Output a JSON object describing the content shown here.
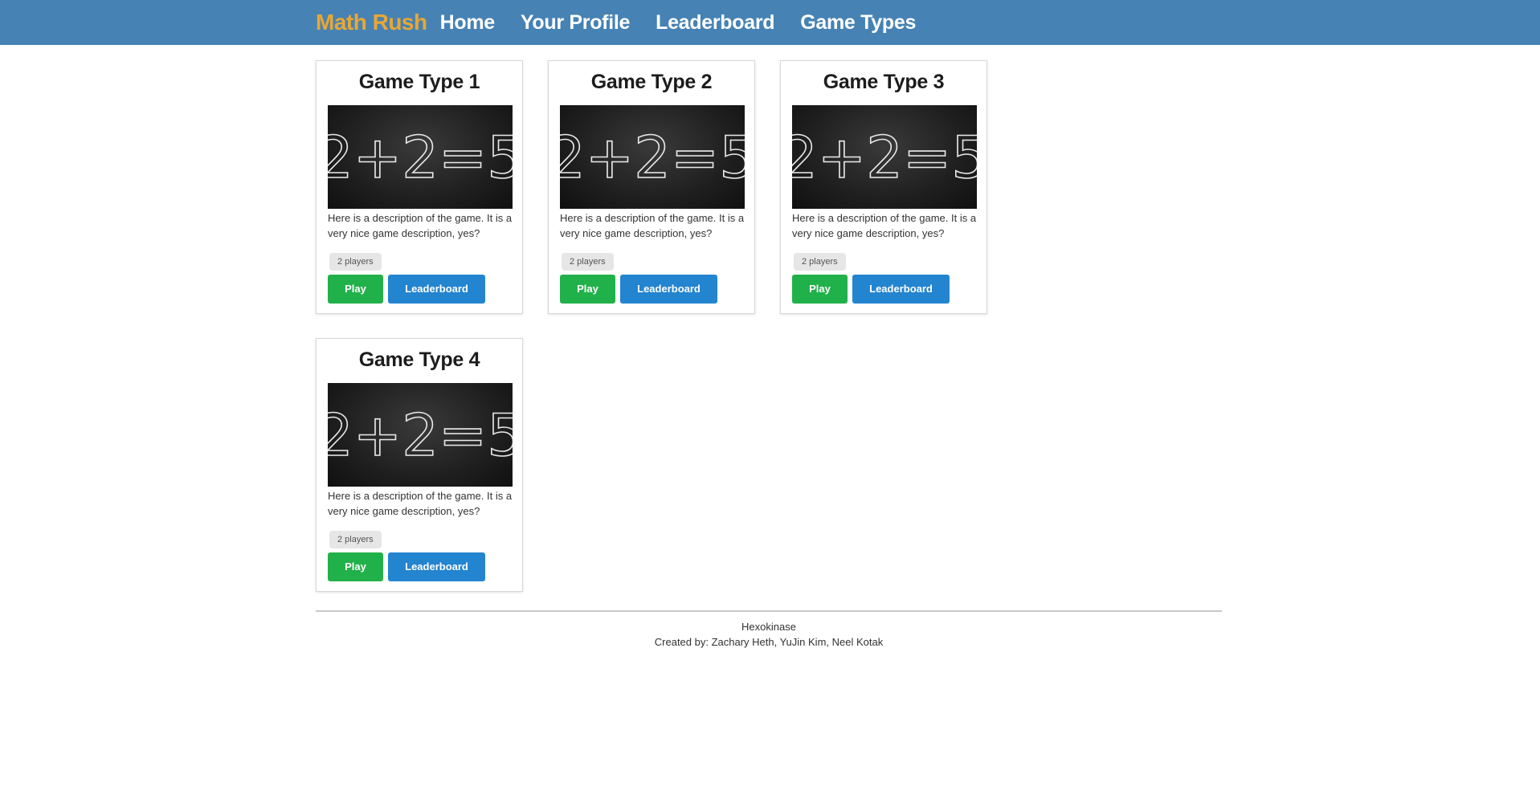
{
  "nav": {
    "brand": "Math Rush",
    "links": [
      "Home",
      "Your Profile",
      "Leaderboard",
      "Game Types"
    ]
  },
  "cards": [
    {
      "title": "Game Type 1",
      "image_text": "2+2=5",
      "description": "Here is a description of the game. It is a very nice game description, yes?",
      "badge": "2 players",
      "play_label": "Play",
      "leaderboard_label": "Leaderboard"
    },
    {
      "title": "Game Type 2",
      "image_text": "2+2=5",
      "description": "Here is a description of the game. It is a very nice game description, yes?",
      "badge": "2 players",
      "play_label": "Play",
      "leaderboard_label": "Leaderboard"
    },
    {
      "title": "Game Type 3",
      "image_text": "2+2=5",
      "description": "Here is a description of the game. It is a very nice game description, yes?",
      "badge": "2 players",
      "play_label": "Play",
      "leaderboard_label": "Leaderboard"
    },
    {
      "title": "Game Type 4",
      "image_text": "2+2=5",
      "description": "Here is a description of the game. It is a very nice game description, yes?",
      "badge": "2 players",
      "play_label": "Play",
      "leaderboard_label": "Leaderboard"
    }
  ],
  "footer": {
    "name": "Hexokinase",
    "credits": "Created by: Zachary Heth, YuJin Kim, Neel Kotak"
  },
  "colors": {
    "navbar": "#4682b4",
    "brand": "#e8a735",
    "play_button": "#21b14a",
    "leaderboard_button": "#2384d0"
  }
}
